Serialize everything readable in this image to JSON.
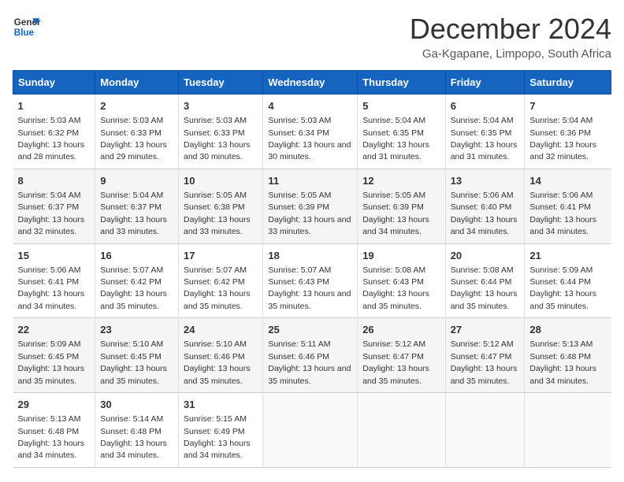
{
  "logo": {
    "line1": "General",
    "line2": "Blue"
  },
  "title": "December 2024",
  "subtitle": "Ga-Kgapane, Limpopo, South Africa",
  "days_of_week": [
    "Sunday",
    "Monday",
    "Tuesday",
    "Wednesday",
    "Thursday",
    "Friday",
    "Saturday"
  ],
  "weeks": [
    [
      {
        "day": 1,
        "sunrise": "5:03 AM",
        "sunset": "6:32 PM",
        "daylight": "13 hours and 28 minutes."
      },
      {
        "day": 2,
        "sunrise": "5:03 AM",
        "sunset": "6:33 PM",
        "daylight": "13 hours and 29 minutes."
      },
      {
        "day": 3,
        "sunrise": "5:03 AM",
        "sunset": "6:33 PM",
        "daylight": "13 hours and 30 minutes."
      },
      {
        "day": 4,
        "sunrise": "5:03 AM",
        "sunset": "6:34 PM",
        "daylight": "13 hours and 30 minutes."
      },
      {
        "day": 5,
        "sunrise": "5:04 AM",
        "sunset": "6:35 PM",
        "daylight": "13 hours and 31 minutes."
      },
      {
        "day": 6,
        "sunrise": "5:04 AM",
        "sunset": "6:35 PM",
        "daylight": "13 hours and 31 minutes."
      },
      {
        "day": 7,
        "sunrise": "5:04 AM",
        "sunset": "6:36 PM",
        "daylight": "13 hours and 32 minutes."
      }
    ],
    [
      {
        "day": 8,
        "sunrise": "5:04 AM",
        "sunset": "6:37 PM",
        "daylight": "13 hours and 32 minutes."
      },
      {
        "day": 9,
        "sunrise": "5:04 AM",
        "sunset": "6:37 PM",
        "daylight": "13 hours and 33 minutes."
      },
      {
        "day": 10,
        "sunrise": "5:05 AM",
        "sunset": "6:38 PM",
        "daylight": "13 hours and 33 minutes."
      },
      {
        "day": 11,
        "sunrise": "5:05 AM",
        "sunset": "6:39 PM",
        "daylight": "13 hours and 33 minutes."
      },
      {
        "day": 12,
        "sunrise": "5:05 AM",
        "sunset": "6:39 PM",
        "daylight": "13 hours and 34 minutes."
      },
      {
        "day": 13,
        "sunrise": "5:06 AM",
        "sunset": "6:40 PM",
        "daylight": "13 hours and 34 minutes."
      },
      {
        "day": 14,
        "sunrise": "5:06 AM",
        "sunset": "6:41 PM",
        "daylight": "13 hours and 34 minutes."
      }
    ],
    [
      {
        "day": 15,
        "sunrise": "5:06 AM",
        "sunset": "6:41 PM",
        "daylight": "13 hours and 34 minutes."
      },
      {
        "day": 16,
        "sunrise": "5:07 AM",
        "sunset": "6:42 PM",
        "daylight": "13 hours and 35 minutes."
      },
      {
        "day": 17,
        "sunrise": "5:07 AM",
        "sunset": "6:42 PM",
        "daylight": "13 hours and 35 minutes."
      },
      {
        "day": 18,
        "sunrise": "5:07 AM",
        "sunset": "6:43 PM",
        "daylight": "13 hours and 35 minutes."
      },
      {
        "day": 19,
        "sunrise": "5:08 AM",
        "sunset": "6:43 PM",
        "daylight": "13 hours and 35 minutes."
      },
      {
        "day": 20,
        "sunrise": "5:08 AM",
        "sunset": "6:44 PM",
        "daylight": "13 hours and 35 minutes."
      },
      {
        "day": 21,
        "sunrise": "5:09 AM",
        "sunset": "6:44 PM",
        "daylight": "13 hours and 35 minutes."
      }
    ],
    [
      {
        "day": 22,
        "sunrise": "5:09 AM",
        "sunset": "6:45 PM",
        "daylight": "13 hours and 35 minutes."
      },
      {
        "day": 23,
        "sunrise": "5:10 AM",
        "sunset": "6:45 PM",
        "daylight": "13 hours and 35 minutes."
      },
      {
        "day": 24,
        "sunrise": "5:10 AM",
        "sunset": "6:46 PM",
        "daylight": "13 hours and 35 minutes."
      },
      {
        "day": 25,
        "sunrise": "5:11 AM",
        "sunset": "6:46 PM",
        "daylight": "13 hours and 35 minutes."
      },
      {
        "day": 26,
        "sunrise": "5:12 AM",
        "sunset": "6:47 PM",
        "daylight": "13 hours and 35 minutes."
      },
      {
        "day": 27,
        "sunrise": "5:12 AM",
        "sunset": "6:47 PM",
        "daylight": "13 hours and 35 minutes."
      },
      {
        "day": 28,
        "sunrise": "5:13 AM",
        "sunset": "6:48 PM",
        "daylight": "13 hours and 34 minutes."
      }
    ],
    [
      {
        "day": 29,
        "sunrise": "5:13 AM",
        "sunset": "6:48 PM",
        "daylight": "13 hours and 34 minutes."
      },
      {
        "day": 30,
        "sunrise": "5:14 AM",
        "sunset": "6:48 PM",
        "daylight": "13 hours and 34 minutes."
      },
      {
        "day": 31,
        "sunrise": "5:15 AM",
        "sunset": "6:49 PM",
        "daylight": "13 hours and 34 minutes."
      },
      null,
      null,
      null,
      null
    ]
  ],
  "labels": {
    "sunrise": "Sunrise:",
    "sunset": "Sunset:",
    "daylight": "Daylight:"
  }
}
